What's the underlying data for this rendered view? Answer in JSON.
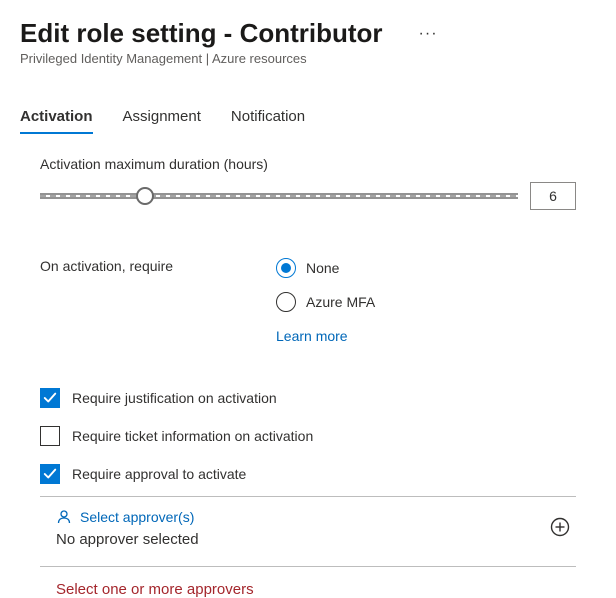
{
  "header": {
    "title": "Edit role setting - Contributor",
    "breadcrumb": "Privileged Identity Management | Azure resources"
  },
  "tabs": [
    {
      "label": "Activation",
      "active": true
    },
    {
      "label": "Assignment",
      "active": false
    },
    {
      "label": "Notification",
      "active": false
    }
  ],
  "activation": {
    "duration_label": "Activation maximum duration (hours)",
    "duration_value": "6",
    "require_label": "On activation, require",
    "require_options": [
      {
        "label": "None",
        "selected": true
      },
      {
        "label": "Azure MFA",
        "selected": false
      }
    ],
    "learn_more": "Learn more",
    "checks": [
      {
        "label": "Require justification on activation",
        "checked": true
      },
      {
        "label": "Require ticket information on activation",
        "checked": false
      },
      {
        "label": "Require approval to activate",
        "checked": true
      }
    ],
    "approvers": {
      "heading": "Select approver(s)",
      "status": "No approver selected",
      "error": "Select one or more approvers"
    }
  }
}
